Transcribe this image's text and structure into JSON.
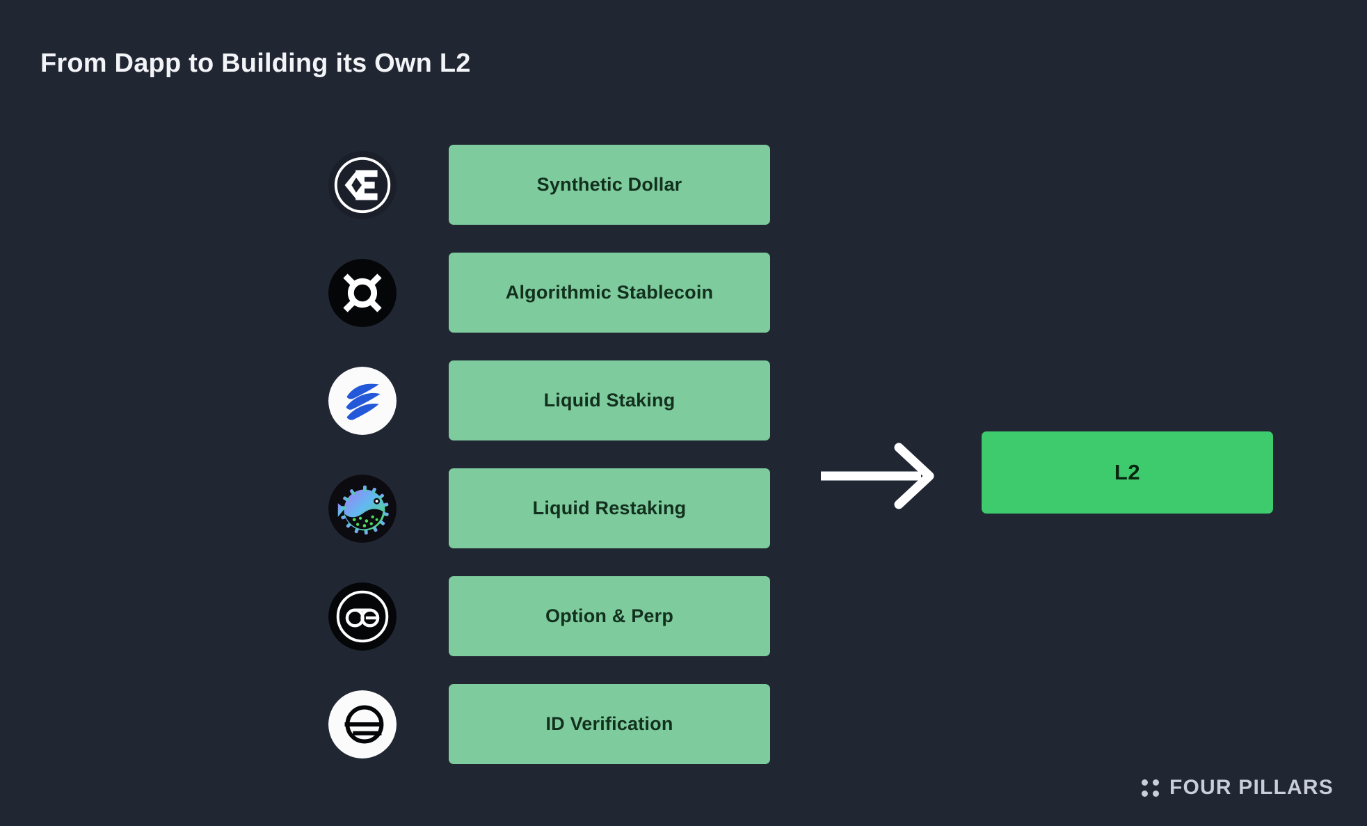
{
  "slide": {
    "title": "From Dapp to Building its Own L2",
    "background_color": "#212633",
    "title_color": "#f2f4f7"
  },
  "categories": [
    {
      "icon": "ethena-logo-icon",
      "label": "Synthetic Dollar"
    },
    {
      "icon": "frax-logo-icon",
      "label": "Algorithmic Stablecoin"
    },
    {
      "icon": "swell-logo-icon",
      "label": "Liquid Staking"
    },
    {
      "icon": "puffer-logo-icon",
      "label": "Liquid Restaking"
    },
    {
      "icon": "aevo-logo-icon",
      "label": "Option & Perp"
    },
    {
      "icon": "worldcoin-logo-icon",
      "label": "ID Verification"
    }
  ],
  "arrow": {
    "icon": "right-arrow-icon",
    "color": "#ffffff"
  },
  "result": {
    "label": "L2",
    "box_color": "#3ecb6d",
    "text_color": "#07260f"
  },
  "pill_style": {
    "box_color": "#7ecb9d",
    "text_color": "#12301d"
  },
  "brand": {
    "name": "FOUR PILLARS",
    "logo_icon": "four-dots-icon",
    "color": "#c9ced8"
  }
}
